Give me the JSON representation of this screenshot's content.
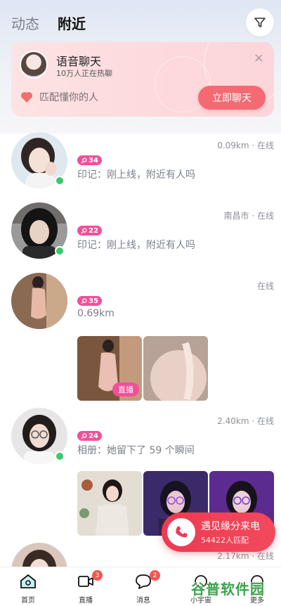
{
  "header": {
    "tabs": [
      {
        "label": "动态",
        "active": false
      },
      {
        "label": "附近",
        "active": true
      }
    ],
    "filter_icon": "filter-icon"
  },
  "banner": {
    "title": "语音聊天",
    "subtitle": "10万人正在热聊",
    "close": "×",
    "match_text": "匹配懂你的人",
    "cta": "立即聊天"
  },
  "feed": [
    {
      "age": "34",
      "meta": "0.09km · 在线",
      "text": "印记：刚上线，附近有人吗",
      "online": true
    },
    {
      "age": "22",
      "meta": "南昌市 · 在线",
      "text": "印记：刚上线，附近有人吗",
      "online": true
    },
    {
      "age": "35",
      "meta": "在线",
      "text": "0.69km",
      "online": false,
      "live_tag": "直播"
    },
    {
      "age": "24",
      "meta": "2.40km · 在线",
      "text": "相册：她留下了 59 个瞬间",
      "online": true
    },
    {
      "meta": "2.17km · 在线"
    }
  ],
  "floating_call": {
    "title": "遇见缘分来电",
    "subtitle": "54422人匹配"
  },
  "bottom_nav": {
    "items": [
      {
        "label": "首页",
        "icon": "home-icon",
        "active": true
      },
      {
        "label": "直播",
        "icon": "video-icon",
        "badge": "3"
      },
      {
        "label": "消息",
        "icon": "message-icon",
        "badge": "2"
      },
      {
        "label": "小宇宙",
        "icon": "planet-icon"
      },
      {
        "label": "更多",
        "icon": "more-icon"
      }
    ]
  },
  "watermark": "谷普软件园",
  "colors": {
    "accent_pink": "#f0509b",
    "cta_red": "#f46a73",
    "online_green": "#37c96b",
    "call_red": "#ee3a51"
  }
}
